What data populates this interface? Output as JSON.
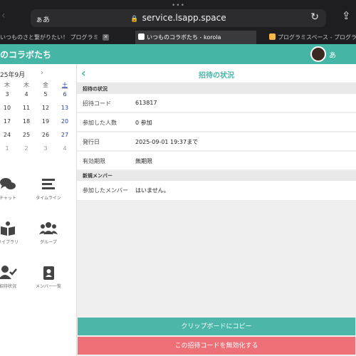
{
  "browser": {
    "reader_label": "ぁあ",
    "url": "service.lsapp.space",
    "tabs": [
      {
        "label": "いつものさと繋がりたい！ プログラミ",
        "active": false
      },
      {
        "label": "いつものコラボたち - korola",
        "active": true
      },
      {
        "label": "プログラミスペース - プログラミング",
        "active": false
      }
    ]
  },
  "app": {
    "title": "のコラボたち",
    "user_initial": "あ"
  },
  "calendar": {
    "month_label": "25年9月",
    "weekdays": [
      "木",
      "木",
      "金",
      "土"
    ],
    "weeks": [
      [
        "3",
        "4",
        "5",
        "6"
      ],
      [
        "10",
        "11",
        "12",
        "13"
      ],
      [
        "17",
        "18",
        "19",
        "20"
      ],
      [
        "24",
        "25",
        "26",
        "27"
      ],
      [
        "1",
        "2",
        "3",
        "4"
      ]
    ]
  },
  "sidebar_menu": [
    {
      "label": "チャット",
      "icon": "chat-icon"
    },
    {
      "label": "タイムライン",
      "icon": "timeline-icon"
    },
    {
      "label": "ライブラリ",
      "icon": "library-icon"
    },
    {
      "label": "グループ",
      "icon": "group-icon"
    },
    {
      "label": "招待状況",
      "icon": "user-check-icon"
    },
    {
      "label": "メンバー一覧",
      "icon": "address-book-icon"
    }
  ],
  "main": {
    "title": "招待の状況",
    "sections": [
      {
        "heading": "招待の状況",
        "rows": [
          {
            "label": "招待コード",
            "value": "613817"
          },
          {
            "label": "参加した人数",
            "value": "0 参加"
          },
          {
            "label": "発行日",
            "value": "2025-09-01 19:37まで"
          },
          {
            "label": "有効期限",
            "value": "無期限"
          }
        ]
      },
      {
        "heading": "新規メンバー",
        "rows": [
          {
            "label": "参加したメンバー",
            "value": "はいません。"
          }
        ]
      }
    ],
    "copy_button": "クリップボードにコピー",
    "disable_button": "この招待コードを無効化する"
  },
  "colors": {
    "accent": "#45b6a6",
    "danger": "#ef6f77",
    "chrome_bg": "#1e1e20"
  }
}
